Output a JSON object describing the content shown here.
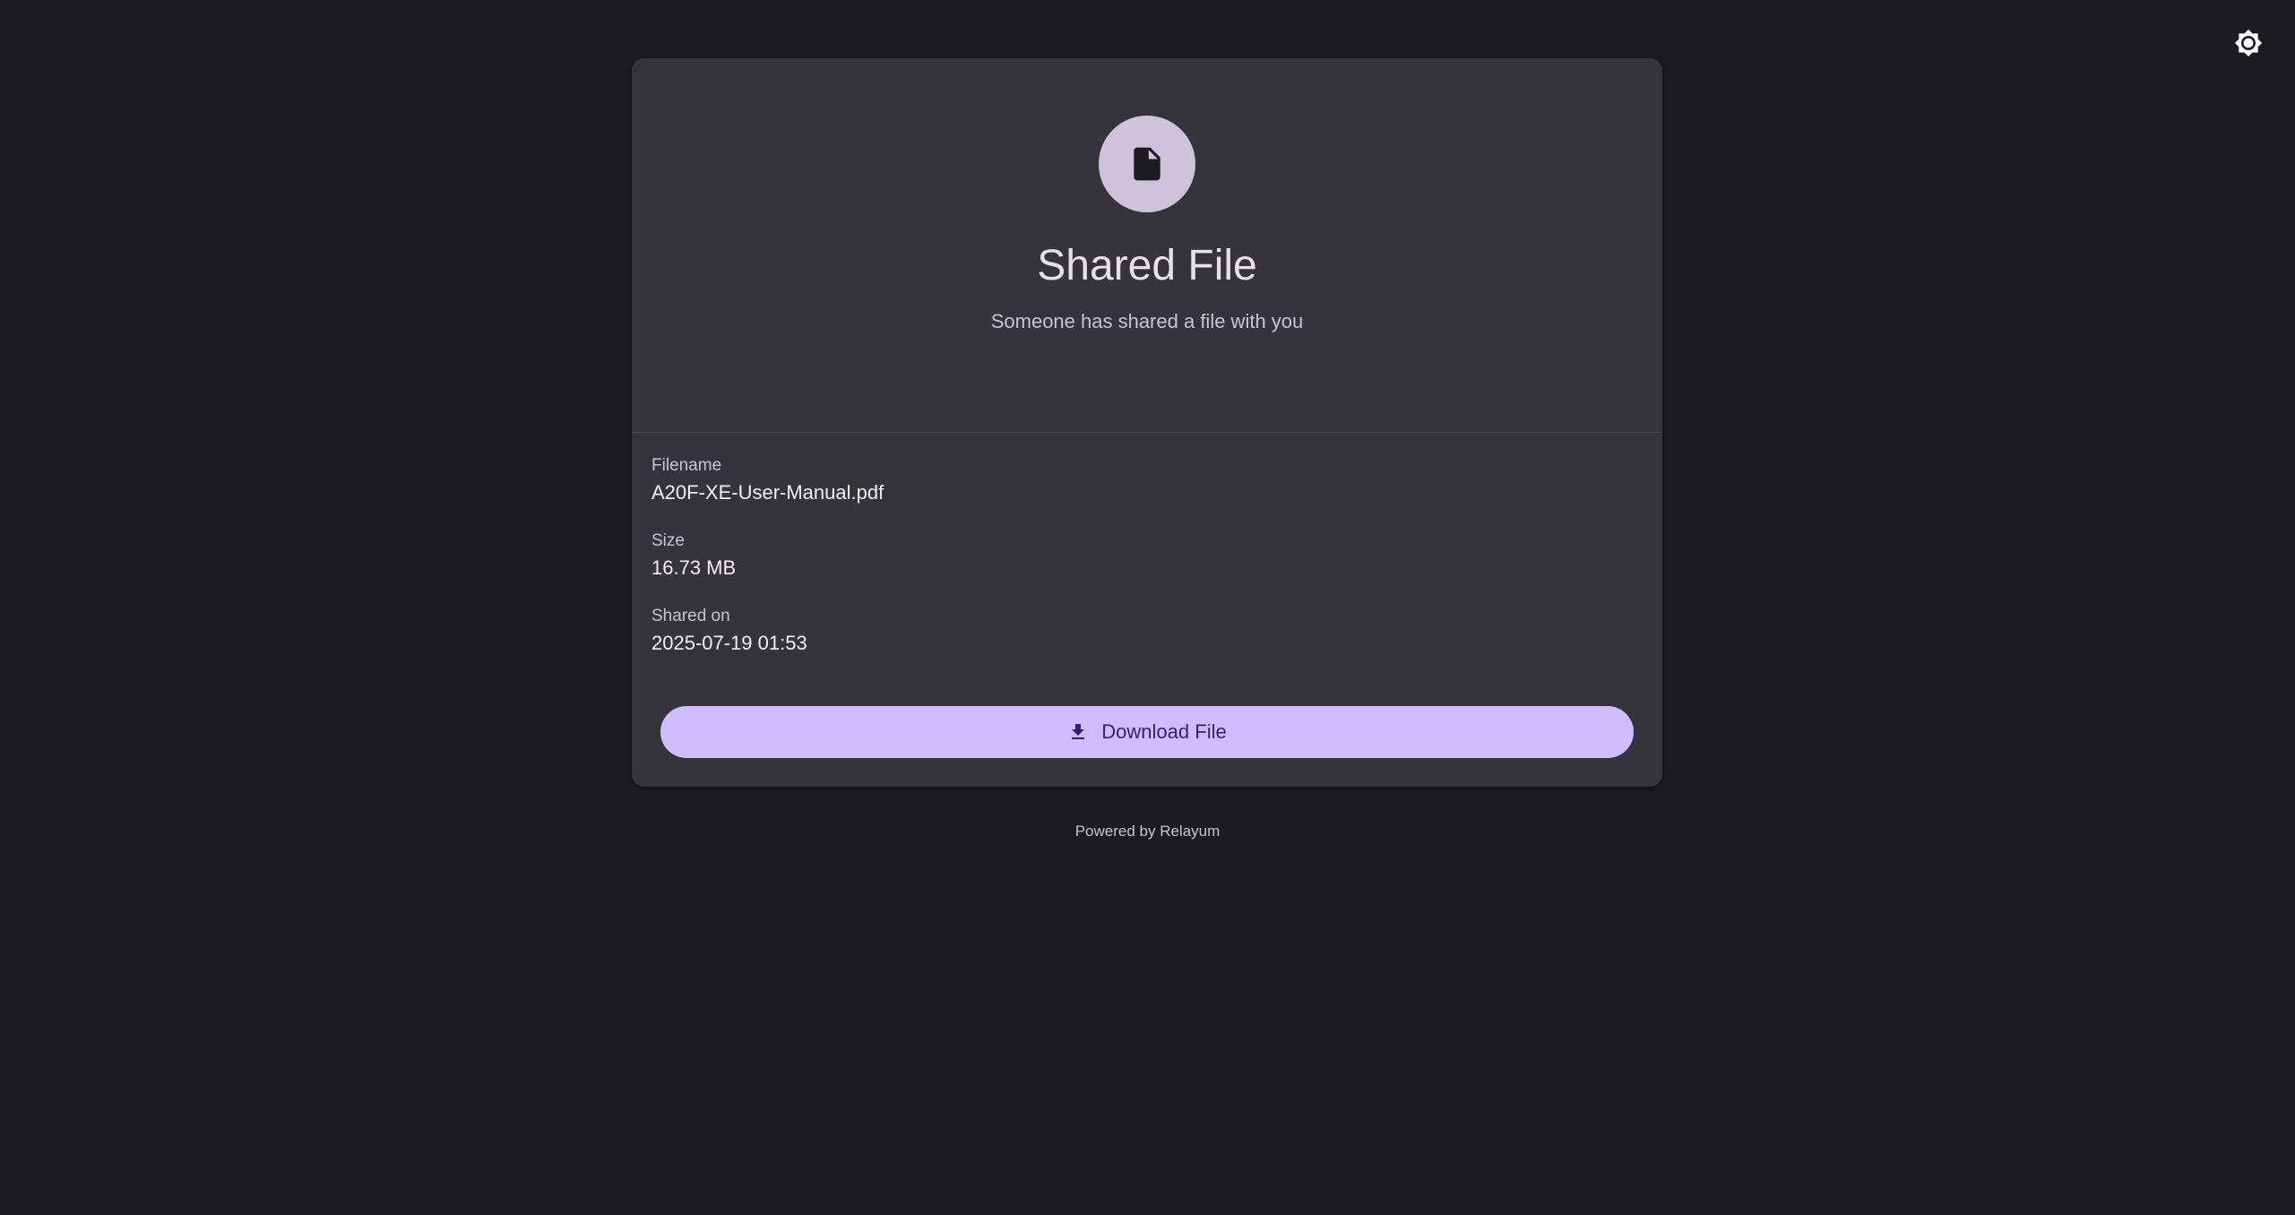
{
  "theme_toggle": {
    "icon": "brightness-icon"
  },
  "card": {
    "icon": "file-icon",
    "title": "Shared File",
    "subtitle": "Someone has shared a file with you"
  },
  "details": {
    "filename_label": "Filename",
    "filename_value": "A20F-XE-User-Manual.pdf",
    "size_label": "Size",
    "size_value": "16.73 MB",
    "shared_label": "Shared on",
    "shared_value": "2025-07-19 01:53"
  },
  "download": {
    "label": "Download File",
    "icon": "download-icon"
  },
  "footer": {
    "text": "Powered by Relayum"
  },
  "colors": {
    "background": "#1c1b20",
    "card": "#36343b",
    "accent": "#d0bcff",
    "avatar": "#cec2dd"
  }
}
